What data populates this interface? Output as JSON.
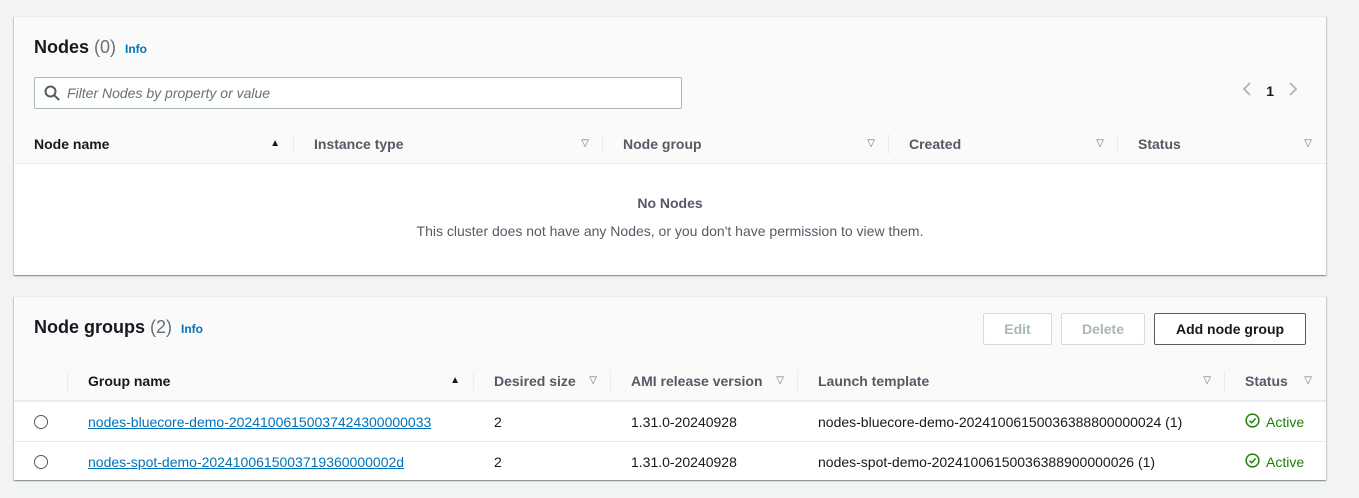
{
  "nodes_panel": {
    "title": "Nodes",
    "count": "(0)",
    "info": "Info",
    "filter_placeholder": "Filter Nodes by property or value",
    "page": "1",
    "columns": [
      "Node name",
      "Instance type",
      "Node group",
      "Created",
      "Status"
    ],
    "empty_title": "No Nodes",
    "empty_desc": "This cluster does not have any Nodes, or you don't have permission to view them."
  },
  "nodegroups_panel": {
    "title": "Node groups",
    "count": "(2)",
    "info": "Info",
    "buttons": {
      "edit": "Edit",
      "delete": "Delete",
      "add": "Add node group"
    },
    "columns": [
      "Group name",
      "Desired size",
      "AMI release version",
      "Launch template",
      "Status"
    ],
    "rows": [
      {
        "group_name": "nodes-bluecore-demo-20241006150037424300000033",
        "desired_size": "2",
        "ami_version": "1.31.0-20240928",
        "launch_template": "nodes-bluecore-demo-20241006150036388800000024 (1)",
        "status": "Active"
      },
      {
        "group_name": "nodes-spot-demo-2024100615003719360000002d",
        "desired_size": "2",
        "ami_version": "1.31.0-20240928",
        "launch_template": "nodes-spot-demo-20241006150036388900000026 (1)",
        "status": "Active"
      }
    ]
  },
  "colors": {
    "link": "#0073bb",
    "success": "#1d8102",
    "header_bg": "#fafafa",
    "page_bg": "#f2f3f3"
  },
  "icons": {
    "search": "search-icon",
    "sort_asc": "sort-ascending-icon",
    "sort": "sort-icon",
    "prev": "chevron-left-icon",
    "next": "chevron-right-icon",
    "status": "check-circle-icon"
  }
}
